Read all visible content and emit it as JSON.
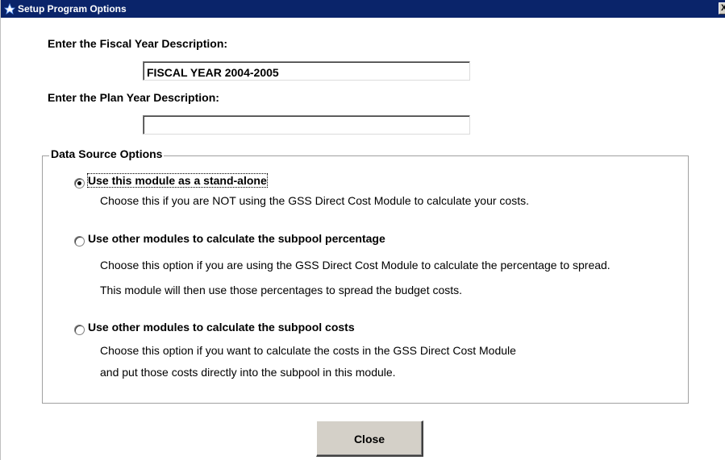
{
  "window": {
    "title": "Setup Program Options",
    "close_glyph": "X",
    "icon": "app-icon"
  },
  "fiscal_year": {
    "label": "Enter the Fiscal Year Description:",
    "value": "FISCAL YEAR 2004-2005"
  },
  "plan_year": {
    "label": "Enter the Plan Year Description:",
    "value": ""
  },
  "data_source": {
    "legend": "Data Source Options",
    "options": [
      {
        "label": "Use this module as a stand-alone",
        "selected": true,
        "desc1": "Choose this if you are NOT using the GSS Direct Cost Module to calculate your costs.",
        "desc2": ""
      },
      {
        "label": "Use other modules to calculate the subpool percentage",
        "selected": false,
        "desc1": "Choose this option if you are using the GSS Direct Cost Module to calculate the percentage to spread.",
        "desc2": "This module will then use those percentages to spread the budget costs."
      },
      {
        "label": "Use other modules to calculate the subpool costs",
        "selected": false,
        "desc1": "Choose this option if you want to calculate the costs in the GSS Direct Cost Module",
        "desc2": "and put those costs directly into the subpool in this module."
      }
    ]
  },
  "buttons": {
    "close_label": "Close"
  },
  "colors": {
    "titlebar": "#0a246a",
    "button_face": "#d4d0c8"
  }
}
